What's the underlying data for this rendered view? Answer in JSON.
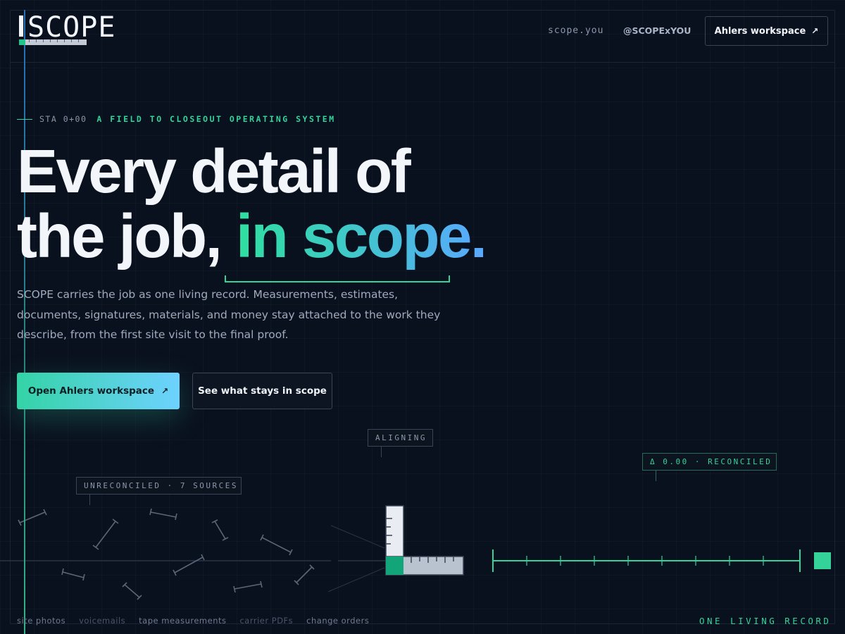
{
  "brand": {
    "name": "SCOPE"
  },
  "nav": {
    "domain": "scope.you",
    "handle": "@SCOPExYOU",
    "workspace_button": "Ahlers workspace",
    "arrow": "↗"
  },
  "hero": {
    "station": "STA 0+00",
    "eyebrow": "A FIELD TO CLOSEOUT OPERATING SYSTEM",
    "headline_line1": "Every detail of",
    "headline_line2_plain": "the job, ",
    "headline_line2_accent": "in scope.",
    "lead": "SCOPE carries the job as one living record. Measurements, estimates, documents, signatures, materials, and money stay attached to the work they describe, from the first site visit to the final proof.",
    "primary_cta": "Open Ahlers workspace",
    "secondary_cta": "See what stays in scope"
  },
  "diagram": {
    "label_unreconciled": "UNRECONCILED · 7 SOURCES",
    "label_aligning": "ALIGNING",
    "label_reconciled": "Δ 0.00 · RECONCILED",
    "sources": [
      "site photos",
      "voicemails",
      "tape measurements",
      "carrier PDFs",
      "change orders"
    ],
    "footer_tag": "ONE LIVING RECORD"
  },
  "colors": {
    "background": "#0a111e",
    "accent_green": "#34d399",
    "accent_blue": "#5aa8ff",
    "muted_text": "#9fabbd"
  },
  "icons": [
    "arrow-up-right-icon",
    "ruler-square-icon"
  ]
}
